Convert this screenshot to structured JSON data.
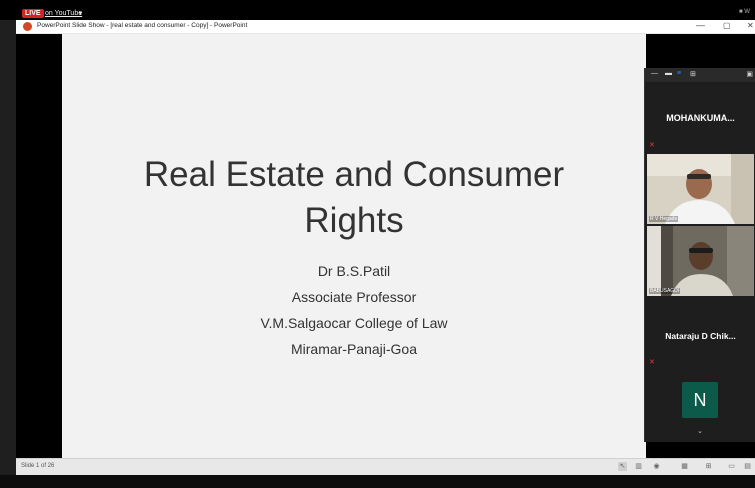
{
  "topbar": {
    "live_label": "LIVE",
    "youtube_label": "on YouTube",
    "caret": "▾",
    "corner_text": "■ W"
  },
  "window": {
    "title": "PowerPoint Slide Show - [real estate and consumer - Copy] - PowerPoint",
    "min_glyph": "—",
    "max_glyph": "▢",
    "close_glyph": "✕"
  },
  "slide": {
    "title": "Real Estate and Consumer\nRights",
    "lines": [
      "Dr B.S.Patil",
      "Associate Professor",
      "V.M.Salgaocar College of Law",
      "Miramar-Panaji-Goa"
    ]
  },
  "statusbar": {
    "slide_count": "Slide 1 of 26",
    "icons": [
      "pointer-icon",
      "notes-icon",
      "settings-icon",
      "grid-icon",
      "slide-sorter-icon",
      "normal-view-icon",
      "reading-view-icon"
    ]
  },
  "gallery": {
    "participants": [
      {
        "name": "MOHANKUMA...",
        "muted": true
      },
      {
        "name": "R V Hegade",
        "muted": false
      },
      {
        "name": "BABUSAGDI",
        "muted": false
      },
      {
        "name": "Nataraju D Chik...",
        "muted": true
      },
      {
        "name": "N",
        "muted": false
      }
    ]
  },
  "colors": {
    "live_red": "#d62222",
    "zoom_blue": "#2d8cff",
    "avatar_green": "#0b5a4a"
  }
}
